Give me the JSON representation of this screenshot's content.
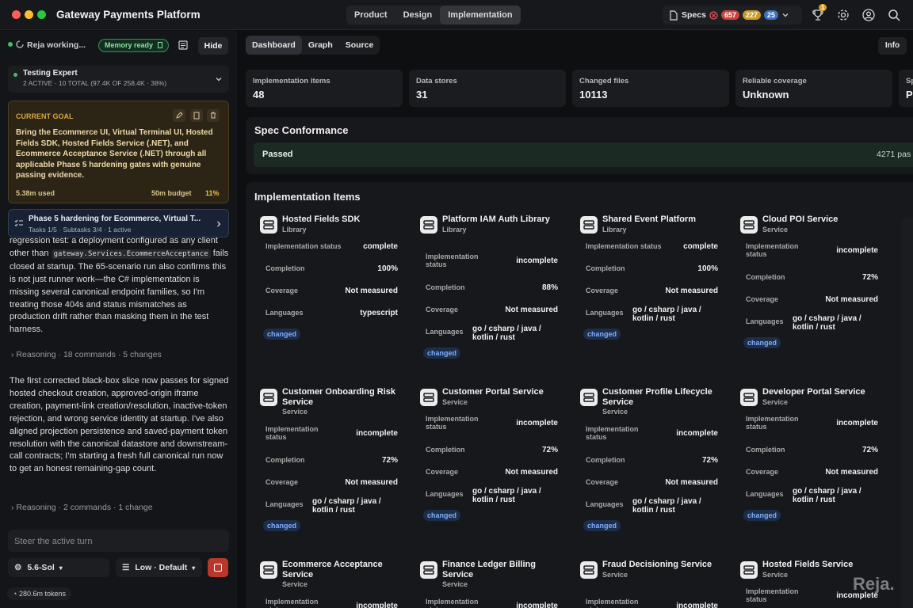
{
  "app": {
    "title": "Gateway Payments Platform"
  },
  "modes": [
    "Product",
    "Design",
    "Implementation"
  ],
  "specs": {
    "label": "Specs",
    "red": "657",
    "yellow": "227",
    "blue": "25",
    "trophy_badge": "1"
  },
  "sidebar": {
    "status": "Reja working...",
    "memory": "Memory ready",
    "hide": "Hide",
    "expert_title": "Testing Expert",
    "expert_sub": "2 ACTIVE · 10 TOTAL (97.4K OF 258.4K · 38%)",
    "goal_title": "CURRENT GOAL",
    "goal_text": "Bring the Ecommerce UI, Virtual Terminal UI, Hosted Fields SDK, Hosted Fields Service (.NET), and Ecommerce Acceptance Service (.NET) through all applicable Phase 5 hardening gates with genuine passing evidence.",
    "goal_used": "5.38m used",
    "goal_budget": "50m budget",
    "goal_pct": "11%",
    "phase_title": "Phase 5 hardening for Ecommerce, Virtual T...",
    "phase_sub": "Tasks 1/5 · Subtasks 3/4 · 1 active",
    "msg1_a": "regression test: a deployment configured as any client other than",
    "msg1_code": "gateway.Services.EcommerceAcceptance",
    "msg1_b": "fails closed at startup. The 65-scenario run also confirms this is not just runner work—the C# implementation is missing several canonical endpoint families, so I'm treating those 404s and status mismatches as production drift rather than masking them in the test harness.",
    "reason1": "Reasoning · 18 commands · 5 changes",
    "msg2": "The first corrected black-box slice now passes for signed hosted checkout creation, approved-origin iframe creation, payment-link creation/resolution, inactive-token rejection, and wrong service identity at startup. I've also aligned projection persistence and saved-payment token resolution with the canonical datastore and downstream-call contracts; I'm starting a fresh full canonical run now to get an honest remaining-gap count.",
    "reason2": "Reasoning · 2 commands · 1 change",
    "steer_placeholder": "Steer the active turn",
    "model": "5.6-Sol",
    "effort": "Low · Default",
    "tokens": "280.6m tokens"
  },
  "main": {
    "tabs": [
      "Dashboard",
      "Graph",
      "Source"
    ],
    "info": "Info",
    "stats": [
      {
        "label": "Implementation items",
        "value": "48"
      },
      {
        "label": "Data stores",
        "value": "31"
      },
      {
        "label": "Changed files",
        "value": "10113"
      },
      {
        "label": "Reliable coverage",
        "value": "Unknown"
      },
      {
        "label": "Sp",
        "value": "P"
      }
    ],
    "spec_title": "Spec Conformance",
    "spec_status": "Passed",
    "spec_count": "4271 pas",
    "items_title": "Implementation Items",
    "row_labels": {
      "status": "Implementation status",
      "completion": "Completion",
      "coverage": "Coverage",
      "languages": "Languages"
    },
    "badge": "changed",
    "cards": [
      {
        "name": "Hosted Fields SDK",
        "type": "Library",
        "status": "complete",
        "completion": "100%",
        "coverage": "Not measured",
        "languages": "typescript"
      },
      {
        "name": "Platform IAM Auth Library",
        "type": "Library",
        "status": "incomplete",
        "completion": "88%",
        "coverage": "Not measured",
        "languages": "go / csharp / java / kotlin / rust"
      },
      {
        "name": "Shared Event Platform",
        "type": "Library",
        "status": "complete",
        "completion": "100%",
        "coverage": "Not measured",
        "languages": "go / csharp / java / kotlin / rust"
      },
      {
        "name": "Cloud POI Service",
        "type": "Service",
        "status": "incomplete",
        "completion": "72%",
        "coverage": "Not measured",
        "languages": "go / csharp / java / kotlin / rust"
      },
      {
        "name": "Customer Onboarding Risk Service",
        "type": "Service",
        "status": "incomplete",
        "completion": "72%",
        "coverage": "Not measured",
        "languages": "go / csharp / java / kotlin / rust"
      },
      {
        "name": "Customer Portal Service",
        "type": "Service",
        "status": "incomplete",
        "completion": "72%",
        "coverage": "Not measured",
        "languages": "go / csharp / java / kotlin / rust"
      },
      {
        "name": "Customer Profile Lifecycle Service",
        "type": "Service",
        "status": "incomplete",
        "completion": "72%",
        "coverage": "Not measured",
        "languages": "go / csharp / java / kotlin / rust"
      },
      {
        "name": "Developer Portal Service",
        "type": "Service",
        "status": "incomplete",
        "completion": "72%",
        "coverage": "Not measured",
        "languages": "go / csharp / java / kotlin / rust"
      },
      {
        "name": "Ecommerce Acceptance Service",
        "type": "Service",
        "status": "incomplete"
      },
      {
        "name": "Finance Ledger Billing Service",
        "type": "Service",
        "status": "incomplete"
      },
      {
        "name": "Fraud Decisioning Service",
        "type": "Service",
        "status": "incomplete"
      },
      {
        "name": "Hosted Fields Service",
        "type": "Service",
        "status": "incomplete"
      }
    ]
  },
  "watermark": "Reja."
}
